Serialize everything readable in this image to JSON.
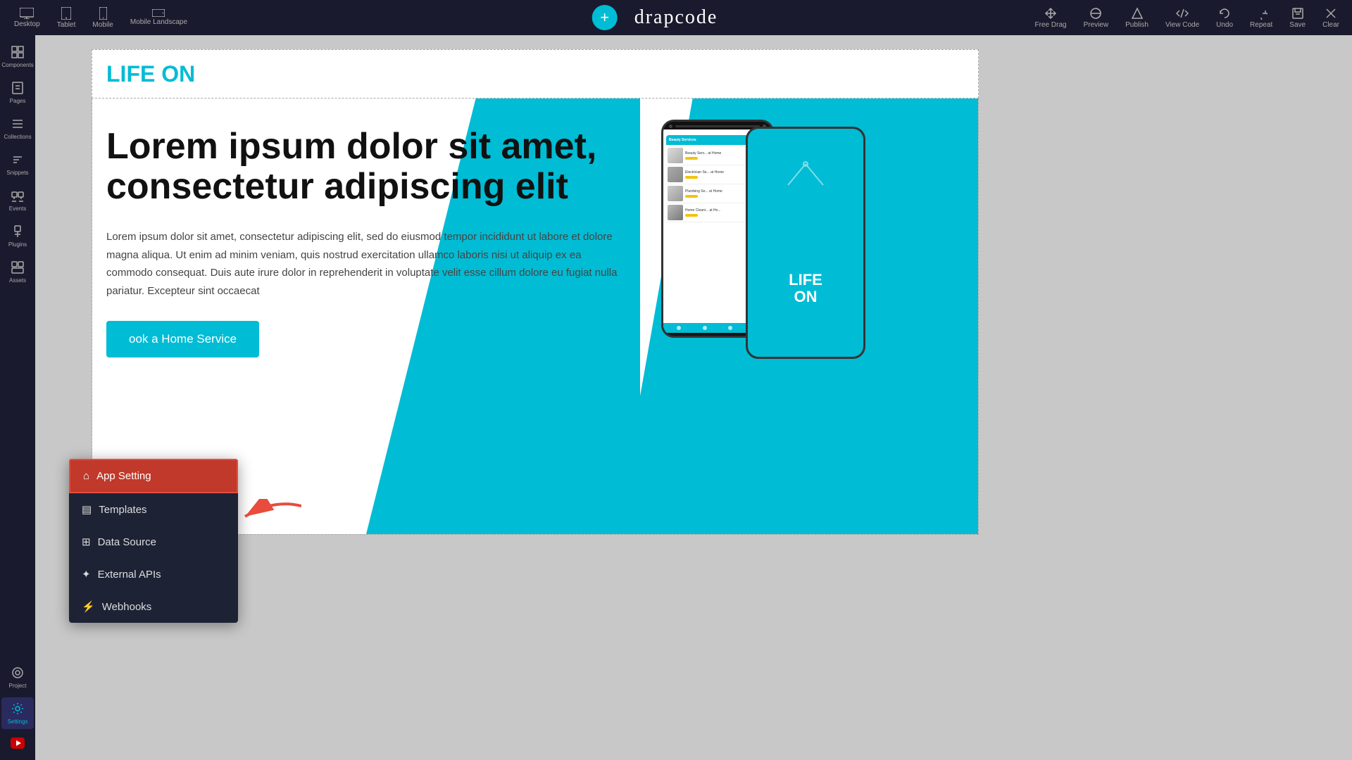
{
  "toolbar": {
    "devices": [
      {
        "label": "Desktop",
        "id": "desktop",
        "active": true
      },
      {
        "label": "Tablet",
        "id": "tablet",
        "active": false
      },
      {
        "label": "Mobile",
        "id": "mobile",
        "active": false
      },
      {
        "label": "Mobile Landscape",
        "id": "mobile-landscape",
        "active": false
      }
    ],
    "add_btn_label": "+",
    "brand": "drapcode",
    "actions": [
      {
        "label": "Free Drag",
        "id": "free-drag"
      },
      {
        "label": "Preview",
        "id": "preview"
      },
      {
        "label": "Publish",
        "id": "publish"
      },
      {
        "label": "View Code",
        "id": "view-code"
      },
      {
        "label": "Undo",
        "id": "undo"
      },
      {
        "label": "Repeat",
        "id": "repeat"
      },
      {
        "label": "Save",
        "id": "save"
      },
      {
        "label": "Clear",
        "id": "clear"
      }
    ]
  },
  "sidebar": {
    "items": [
      {
        "label": "Components",
        "id": "components"
      },
      {
        "label": "Pages",
        "id": "pages"
      },
      {
        "label": "Collections",
        "id": "collections"
      },
      {
        "label": "Snippets",
        "id": "snippets"
      },
      {
        "label": "Events",
        "id": "events"
      },
      {
        "label": "Plugins",
        "id": "plugins"
      },
      {
        "label": "Assets",
        "id": "assets"
      },
      {
        "label": "Project",
        "id": "project"
      },
      {
        "label": "Settings",
        "id": "settings",
        "active": true
      }
    ]
  },
  "popup_menu": {
    "items": [
      {
        "label": "App Setting",
        "id": "app-setting",
        "highlighted": true,
        "icon": "home"
      },
      {
        "label": "Templates",
        "id": "templates",
        "highlighted": false,
        "icon": "file"
      },
      {
        "label": "Data Source",
        "id": "data-source",
        "highlighted": false,
        "icon": "database"
      },
      {
        "label": "External APIs",
        "id": "external-apis",
        "highlighted": false,
        "icon": "asterisk"
      },
      {
        "label": "Webhooks",
        "id": "webhooks",
        "highlighted": false,
        "icon": "bolt"
      }
    ]
  },
  "hero": {
    "life_on_text": "LIFE ",
    "life_on_accent": "ON",
    "heading": "Lorem ipsum dolor sit amet, consectetur adipiscing elit",
    "paragraph": "Lorem ipsum dolor sit amet, consectetur adipiscing elit, sed do eiusmod tempor incididunt ut labore et dolore magna aliqua. Ut enim ad minim veniam, quis nostrud exercitation ullamco laboris nisi ut aliquip ex ea commodo consequat. Duis aute irure dolor in reprehenderit in voluptate velit esse cillum dolore eu fugiat nulla pariatur. Excepteur sint occaecat",
    "cta_label": "ook a Home Service",
    "phone_life": "LIFE",
    "phone_on": "ON"
  }
}
